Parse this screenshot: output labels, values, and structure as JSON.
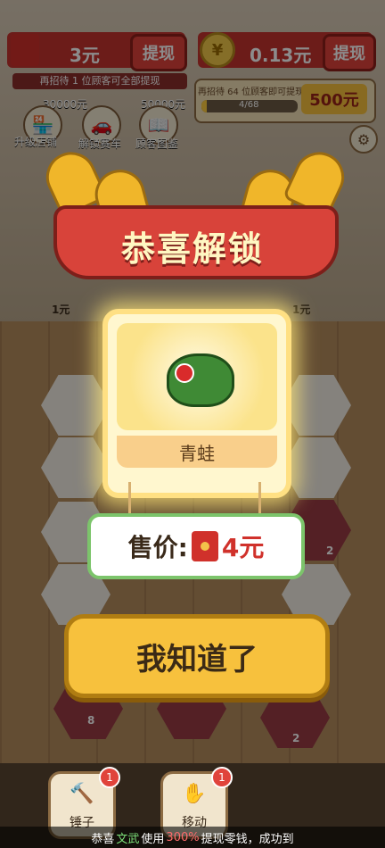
{
  "top_left": {
    "amount": "3元",
    "withdraw_label": "提现",
    "hint": "再招待 1 位顾客可全部提现",
    "mini_amount_1": "30000元",
    "mini_amount_2": "50000元"
  },
  "top_right": {
    "amount": "0.13元",
    "withdraw_label": "提现",
    "progress_text": "4/68",
    "goal_amount": "500元",
    "goal_hint": "再招待 64 位顾客即可提现",
    "progress_fraction": 0.06
  },
  "icons": [
    {
      "name": "shop-upgrade-icon",
      "label": "升级店铺"
    },
    {
      "name": "unlock-car-icon",
      "label": "解锁赛车"
    },
    {
      "name": "customer-guide-icon",
      "label": "顾客图鉴"
    }
  ],
  "banner": {
    "title": "恭喜解锁"
  },
  "card": {
    "item_name": "青蛙"
  },
  "price": {
    "label": "售价:",
    "value": "4元"
  },
  "confirm_button": "我知道了",
  "tiles": [
    "1元",
    "1元",
    "2",
    "8",
    "2"
  ],
  "tools": [
    {
      "name": "hammer",
      "label": "锤子",
      "badge": "1"
    },
    {
      "name": "move",
      "label": "移动",
      "badge": "1"
    }
  ],
  "ticker": {
    "prefix": "恭喜",
    "name": "文武",
    "mid": "使用",
    "percent": "300%",
    "suffix": "提现零钱，成功到"
  }
}
